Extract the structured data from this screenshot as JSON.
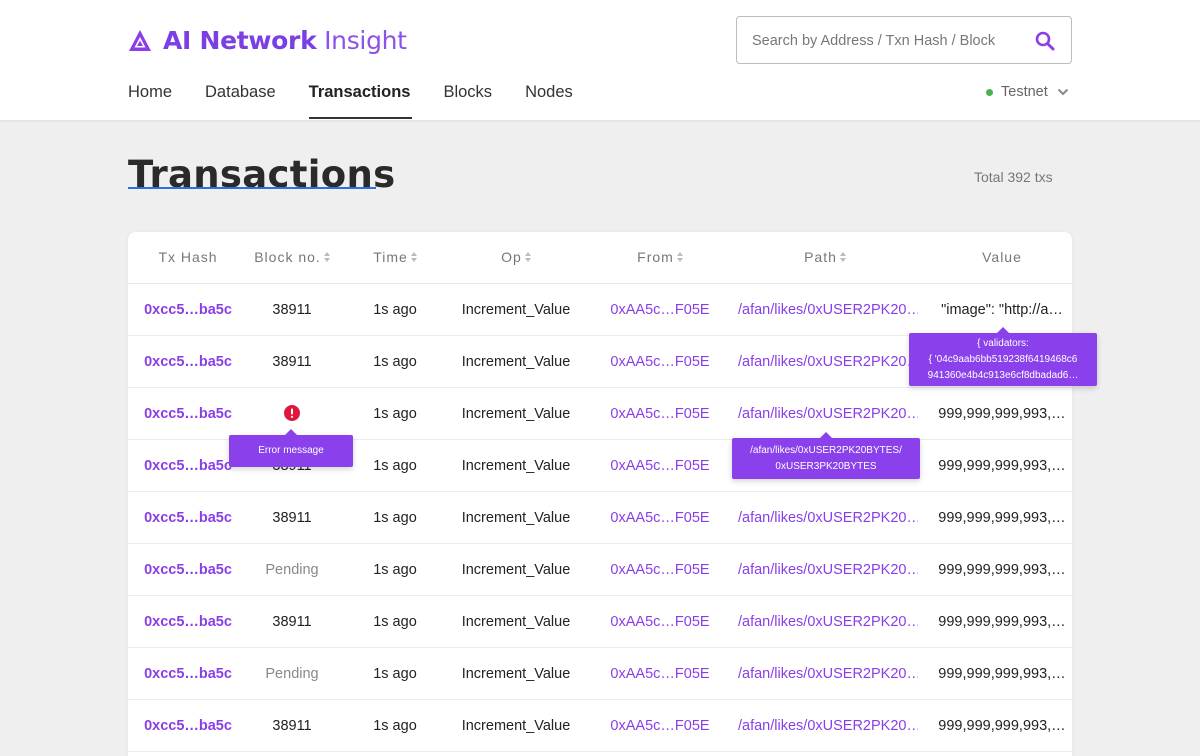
{
  "header": {
    "logo_bold": "AI Network",
    "logo_light": "Insight",
    "search_placeholder": "Search by Address / Txn Hash / Block",
    "network": "Testnet"
  },
  "nav": {
    "items": [
      {
        "label": "Home",
        "active": false
      },
      {
        "label": "Database",
        "active": false
      },
      {
        "label": "Transactions",
        "active": true
      },
      {
        "label": "Blocks",
        "active": false
      },
      {
        "label": "Nodes",
        "active": false
      }
    ]
  },
  "page": {
    "title": "Transactions",
    "total": "Total 392 txs"
  },
  "table": {
    "columns": [
      "Tx Hash",
      "Block no.",
      "Time",
      "Op",
      "From",
      "Path",
      "Value"
    ],
    "rows": [
      {
        "hash": "0xcc5…ba5c",
        "block": "38911",
        "time": "1s ago",
        "op": "Increment_Value",
        "from": "0xAA5c…F05E",
        "path": "/afan/likes/0xUSER2PK20…",
        "value": "\"image\": \"http://a…"
      },
      {
        "hash": "0xcc5…ba5c",
        "block": "38911",
        "time": "1s ago",
        "op": "Increment_Value",
        "from": "0xAA5c…F05E",
        "path": "/afan/likes/0xUSER2PK20…",
        "value": ""
      },
      {
        "hash": "0xcc5…ba5c",
        "block": "",
        "time": "1s ago",
        "op": "Increment_Value",
        "from": "0xAA5c…F05E",
        "path": "/afan/likes/0xUSER2PK20…",
        "value": "999,999,999,993,…"
      },
      {
        "hash": "0xcc5…ba5c",
        "block": "38911",
        "time": "1s ago",
        "op": "Increment_Value",
        "from": "0xAA5c…F05E",
        "path": "/afan/likes/0xUSER2PK20…",
        "value": "999,999,999,993,…"
      },
      {
        "hash": "0xcc5…ba5c",
        "block": "38911",
        "time": "1s ago",
        "op": "Increment_Value",
        "from": "0xAA5c…F05E",
        "path": "/afan/likes/0xUSER2PK20…",
        "value": "999,999,999,993,…"
      },
      {
        "hash": "0xcc5…ba5c",
        "block": "Pending",
        "time": "1s ago",
        "op": "Increment_Value",
        "from": "0xAA5c…F05E",
        "path": "/afan/likes/0xUSER2PK20…",
        "value": "999,999,999,993,…"
      },
      {
        "hash": "0xcc5…ba5c",
        "block": "38911",
        "time": "1s ago",
        "op": "Increment_Value",
        "from": "0xAA5c…F05E",
        "path": "/afan/likes/0xUSER2PK20…",
        "value": "999,999,999,993,…"
      },
      {
        "hash": "0xcc5…ba5c",
        "block": "Pending",
        "time": "1s ago",
        "op": "Increment_Value",
        "from": "0xAA5c…F05E",
        "path": "/afan/likes/0xUSER2PK20…",
        "value": "999,999,999,993,…"
      },
      {
        "hash": "0xcc5…ba5c",
        "block": "38911",
        "time": "1s ago",
        "op": "Increment_Value",
        "from": "0xAA5c…F05E",
        "path": "/afan/likes/0xUSER2PK20…",
        "value": "999,999,999,993,…"
      }
    ]
  },
  "tooltips": {
    "error": "Error message",
    "path_line1": "/afan/likes/0xUSER2PK20BYTES/",
    "path_line2": "0xUSER3PK20BYTES",
    "value_line1": "{ validators:",
    "value_line2": "{ '04c9aab6bb519238f6419468c6",
    "value_line3": "941360e4b4c913e6cf8dbadad6…"
  },
  "colors": {
    "accent": "#8a3ee8",
    "error": "#e0173c",
    "network_dot": "#4caf50",
    "title_underline": "#2f6fd6"
  }
}
